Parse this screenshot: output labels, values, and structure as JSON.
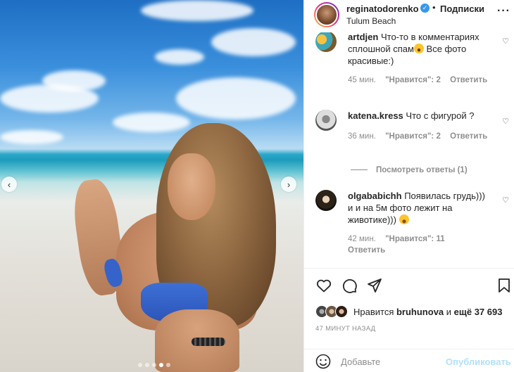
{
  "header": {
    "username": "reginatodorenko",
    "bullet": "•",
    "follow_label": "Подписки",
    "location": "Tulum Beach",
    "more_label": "···"
  },
  "post": {
    "carousel_dots": 5,
    "active_dot": 3
  },
  "comments": [
    {
      "user": "artdjen",
      "text": "Что-то в комментариях сплошной спам",
      "text_after": " Все фото красивые:)",
      "time": "45 мин.",
      "likes": "\"Нравится\": 2",
      "reply": "Ответить"
    },
    {
      "user": "katena.kress",
      "text": "Что с фигурой ?",
      "time": "36 мин.",
      "likes": "\"Нравится\": 2",
      "reply": "Ответить"
    },
    {
      "user": "olgababichh",
      "text": "Появилась грудь))) и и на 5м фото лежит на животике)))",
      "time": "42 мин.",
      "likes": "\"Нравится\": 11",
      "reply": "Ответить"
    }
  ],
  "view_replies": "Посмотреть ответы (1)",
  "likes": {
    "prefix": "Нравится ",
    "user": "bruhunova",
    "connector": " и ",
    "rest": "ещё 37 693"
  },
  "time_ago": "47 МИНУТ НАЗАД",
  "add_comment": {
    "placeholder": "Добавьте",
    "publish_label": "Опубликовать"
  },
  "colors": {
    "verified": "#3897f0",
    "publish_disabled": "#b2dffc",
    "meta": "#8e8e8e"
  }
}
